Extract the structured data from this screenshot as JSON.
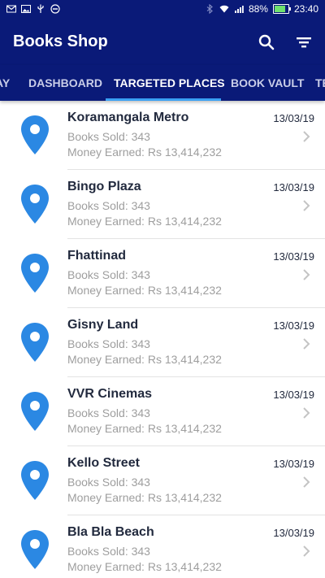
{
  "status_bar": {
    "battery_percent": "88%",
    "time": "23:40",
    "battery_level": 0.88
  },
  "app": {
    "title": "Books Shop"
  },
  "tabs": [
    {
      "label": "AY",
      "active": false
    },
    {
      "label": "DASHBOARD",
      "active": false
    },
    {
      "label": "TARGETED PLACES",
      "active": true
    },
    {
      "label": "BOOK VAULT",
      "active": false
    },
    {
      "label": "TE",
      "active": false
    }
  ],
  "places": [
    {
      "name": "Koramangala Metro",
      "sold": "Books Sold: 343",
      "earned": "Money Earned: Rs 13,414,232",
      "date": "13/03/19"
    },
    {
      "name": "Bingo Plaza",
      "sold": "Books Sold: 343",
      "earned": "Money Earned: Rs 13,414,232",
      "date": "13/03/19"
    },
    {
      "name": "Fhattinad",
      "sold": "Books Sold: 343",
      "earned": "Money Earned: Rs 13,414,232",
      "date": "13/03/19"
    },
    {
      "name": "Gisny Land",
      "sold": "Books Sold: 343",
      "earned": "Money Earned: Rs 13,414,232",
      "date": "13/03/19"
    },
    {
      "name": "VVR Cinemas",
      "sold": "Books Sold: 343",
      "earned": "Money Earned: Rs 13,414,232",
      "date": "13/03/19"
    },
    {
      "name": "Kello Street",
      "sold": "Books Sold: 343",
      "earned": "Money Earned: Rs 13,414,232",
      "date": "13/03/19"
    },
    {
      "name": "Bla Bla Beach",
      "sold": "Books Sold: 343",
      "earned": "Money Earned: Rs 13,414,232",
      "date": "13/03/19"
    }
  ],
  "colors": {
    "app_bar": "#0a1a78",
    "tab_indicator": "#3aa0f3",
    "pin": "#2b88e3",
    "title_text": "#222a3e",
    "secondary_text": "#9e9e9e"
  },
  "icons": {
    "search": "search-icon",
    "filter": "filter-icon",
    "location": "location-pin-icon",
    "chevron": "chevron-right-icon"
  }
}
